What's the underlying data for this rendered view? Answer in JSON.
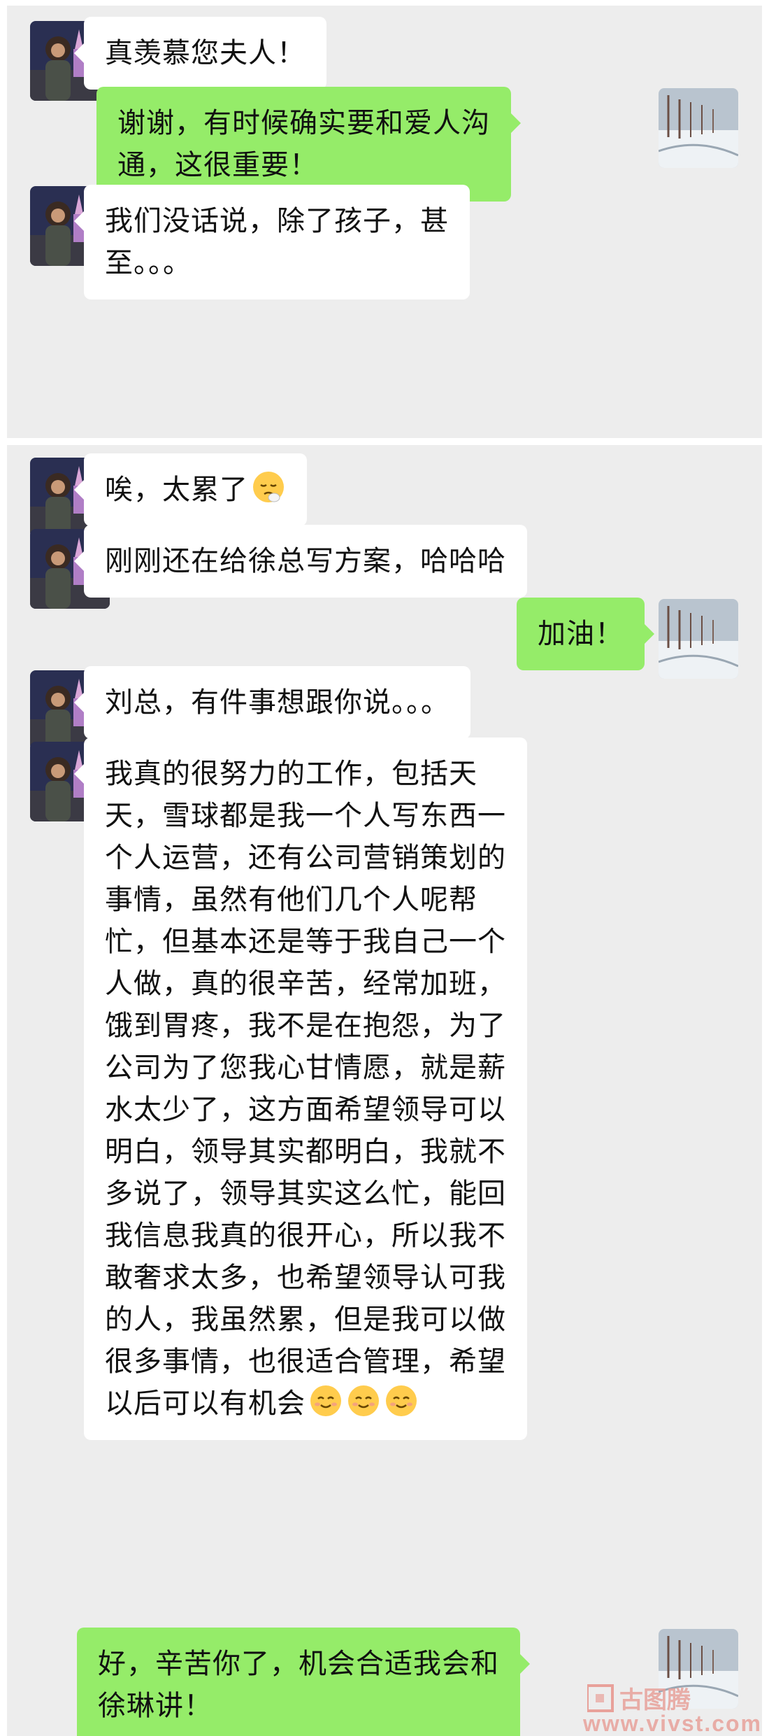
{
  "messages": [
    {
      "id": "m1",
      "side": "left",
      "lines": [
        "真羡慕您夫人！"
      ]
    },
    {
      "id": "m2",
      "side": "right",
      "lines": [
        "谢谢，有时候确实要和爱人沟",
        "通，这很重要！"
      ]
    },
    {
      "id": "m3",
      "side": "left",
      "lines": [
        "我们没话说，除了孩子，甚",
        "至。。。"
      ]
    },
    {
      "id": "m4",
      "side": "left",
      "lines": [
        "唉，太累了"
      ],
      "emoji": "pensive-face-icon"
    },
    {
      "id": "m5",
      "side": "left",
      "lines": [
        "刚刚还在给徐总写方案，哈哈哈"
      ]
    },
    {
      "id": "m6",
      "side": "right",
      "lines": [
        "加油！"
      ]
    },
    {
      "id": "m7",
      "side": "left",
      "lines": [
        "刘总，有件事想跟你说。。。"
      ]
    },
    {
      "id": "m8",
      "side": "left",
      "lines": [
        "我真的很努力的工作，包括天",
        "天，雪球都是我一个人写东西一",
        "个人运营，还有公司营销策划的",
        "事情，虽然有他们几个人呢帮",
        "忙，但基本还是等于我自己一个",
        "人做，真的很辛苦，经常加班，",
        "饿到胃疼，我不是在抱怨，为了",
        "公司为了您我心甘情愿，就是薪",
        "水太少了，这方面希望领导可以",
        "明白，领导其实都明白，我就不",
        "多说了，领导其实这么忙，能回",
        "我信息我真的很开心，所以我不",
        "敢奢求太多，也希望领导认可我",
        "的人，我虽然累，但是我可以做",
        "很多事情，也很适合管理，希望",
        "以后可以有机会"
      ],
      "emoji": "smiling-face-icon",
      "emoji_count": 3
    },
    {
      "id": "m9",
      "side": "right",
      "lines": [
        "好，辛苦你了，机会合适我会和",
        "徐琳讲！"
      ]
    }
  ],
  "watermark": {
    "logo_text": "古图腾",
    "url": "www.vivst.com"
  },
  "colors": {
    "background": "#ededed",
    "bubble_in": "#ffffff",
    "bubble_out": "#95ec69",
    "text": "#111111"
  }
}
